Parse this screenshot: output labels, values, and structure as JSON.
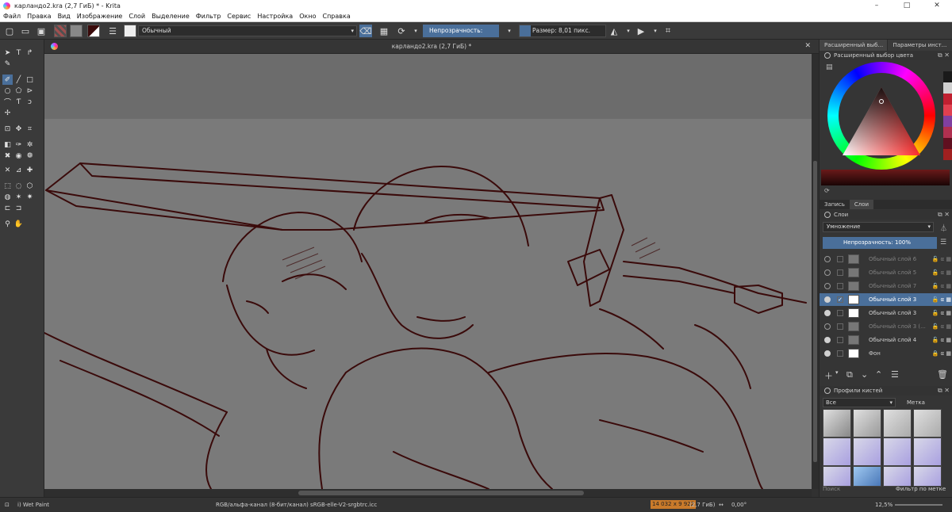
{
  "window": {
    "title": "карландо2.kra (2,7 ГиБ) * - Krita",
    "controls": [
      "–",
      "□",
      "✕"
    ]
  },
  "menu": [
    "Файл",
    "Правка",
    "Вид",
    "Изображение",
    "Слой",
    "Выделение",
    "Фильтр",
    "Сервис",
    "Настройка",
    "Окно",
    "Справка"
  ],
  "toolbar": {
    "blend_mode": "Обычный",
    "opacity": "Непрозрачность: 100%",
    "size": "Размер: 8,01 пикс."
  },
  "document": {
    "tab_title": "карландо2.kra (2,7 ГиБ) *"
  },
  "dock": {
    "tabs": [
      "Расширенный выб...",
      "Параметры инст..."
    ],
    "color_panel_title": "Расширенный выбор цвета",
    "layer_tabs": [
      "Запись",
      "Слои"
    ],
    "layers_panel_title": "Слои",
    "layers_blend": "Умножение",
    "layers_opacity": "Непрозрачность:  100%",
    "layers": [
      {
        "name": "Обычный слой 6",
        "visible": false
      },
      {
        "name": "Обычный слой 5",
        "visible": false
      },
      {
        "name": "Обычный слой 7",
        "visible": false
      },
      {
        "name": "Обычный слой 3",
        "visible": true,
        "selected": true
      },
      {
        "name": "Обычный слой 3",
        "visible": true
      },
      {
        "name": "Обычный слой 3 (...",
        "visible": false
      },
      {
        "name": "Обычный слой 4",
        "visible": true
      },
      {
        "name": "Фон",
        "visible": true
      }
    ],
    "brush_panel_title": "Профили кистей",
    "brush_filter": "Все",
    "brush_tag": "Метка",
    "brush_search": "Поиск",
    "brush_filter_by_tag": "Фильтр по метке"
  },
  "status": {
    "brush": "i) Wet Paint",
    "color_model": "RGB/альфа-канал (8-бит/канал)  sRGB-elle-V2-srgbtrc.icc",
    "image_size": "14 032 x 9 922",
    "memory": "(2,7 ГиБ)",
    "rotation": "0,00°",
    "zoom": "12,5%"
  },
  "colors": {
    "accent": "#4a6f9a",
    "canvas": "#7a7a7a",
    "ink": "#3a0a0a"
  }
}
